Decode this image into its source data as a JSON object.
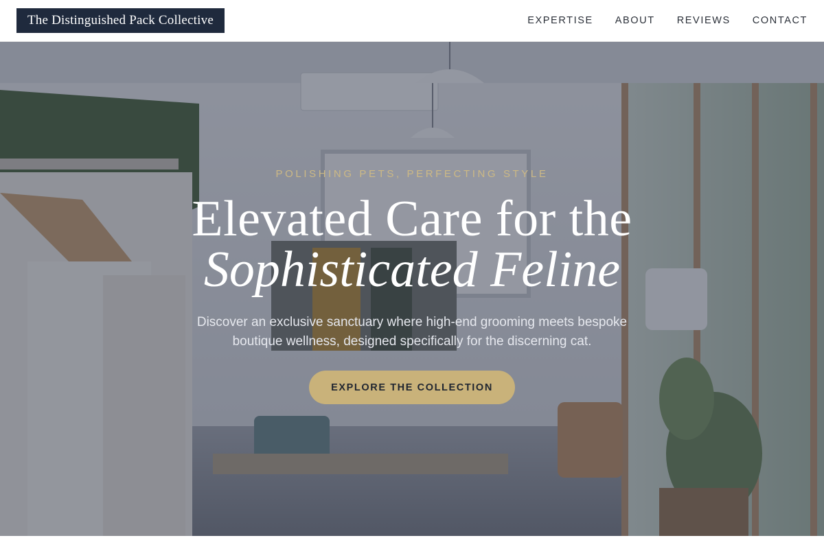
{
  "header": {
    "brand": "The Distinguished Pack Collective",
    "nav": [
      {
        "label": "EXPERTISE"
      },
      {
        "label": "ABOUT"
      },
      {
        "label": "REVIEWS"
      },
      {
        "label": "CONTACT"
      }
    ]
  },
  "hero": {
    "eyebrow": "POLISHING PETS, PERFECTING STYLE",
    "headline_line1": "Elevated Care for the",
    "headline_line2": "Sophisticated Feline",
    "subcopy": "Discover an exclusive sanctuary where high-end grooming meets bespoke boutique wellness, designed specifically for the discerning cat.",
    "cta_label": "EXPLORE THE COLLECTION"
  },
  "colors": {
    "brand_bg": "#1f2a3d",
    "accent_gold": "#c9b27a",
    "eyebrow_gold": "#cdb985",
    "overlay": "#343a4c"
  }
}
